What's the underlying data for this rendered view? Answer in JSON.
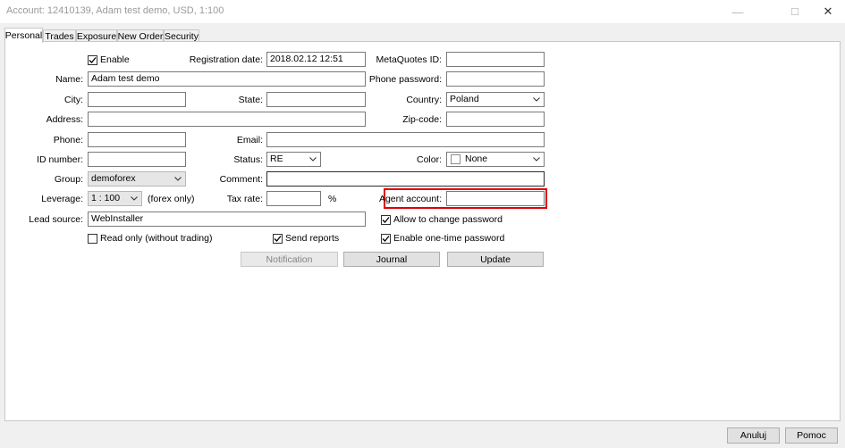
{
  "window": {
    "title": "Account: 12410139, Adam test demo, USD, 1:100",
    "controls": {
      "minimize": "—",
      "maximize": "☐",
      "close": "✕"
    }
  },
  "tabs": [
    "Personal",
    "Trades",
    "Exposure",
    "New Order",
    "Security"
  ],
  "active_tab": "Personal",
  "form": {
    "enable": {
      "label": "Enable",
      "checked": true
    },
    "registration_date": {
      "label": "Registration date:",
      "value": "2018.02.12 12:51"
    },
    "metaquotes_id": {
      "label": "MetaQuotes ID:",
      "value": ""
    },
    "name": {
      "label": "Name:",
      "value": "Adam test demo"
    },
    "phone_password": {
      "label": "Phone password:",
      "value": ""
    },
    "city": {
      "label": "City:",
      "value": ""
    },
    "state": {
      "label": "State:",
      "value": ""
    },
    "country": {
      "label": "Country:",
      "value": "Poland"
    },
    "address": {
      "label": "Address:",
      "value": ""
    },
    "zip_code": {
      "label": "Zip-code:",
      "value": ""
    },
    "phone": {
      "label": "Phone:",
      "value": ""
    },
    "email": {
      "label": "Email:",
      "value": ""
    },
    "id_number": {
      "label": "ID number:",
      "value": ""
    },
    "status": {
      "label": "Status:",
      "value": "RE"
    },
    "color": {
      "label": "Color:",
      "value": "None"
    },
    "group": {
      "label": "Group:",
      "value": "demoforex"
    },
    "comment": {
      "label": "Comment:",
      "value": ""
    },
    "leverage": {
      "label": "Leverage:",
      "value": "1 : 100",
      "note": "(forex only)"
    },
    "tax_rate": {
      "label": "Tax rate:",
      "value": "",
      "unit": "%"
    },
    "agent_account": {
      "label": "Agent account:",
      "value": "",
      "highlight_color": "#e00000"
    },
    "lead_source": {
      "label": "Lead source:",
      "value": "WebInstaller"
    },
    "allow_change_password": {
      "label": "Allow to change password",
      "checked": true
    },
    "read_only": {
      "label": "Read only (without trading)",
      "checked": false
    },
    "send_reports": {
      "label": "Send reports",
      "checked": true
    },
    "enable_otp": {
      "label": "Enable one-time password",
      "checked": true
    }
  },
  "buttons": {
    "notification": "Notification",
    "journal": "Journal",
    "update": "Update"
  },
  "footer": {
    "cancel": "Anuluj",
    "help": "Pomoc"
  }
}
